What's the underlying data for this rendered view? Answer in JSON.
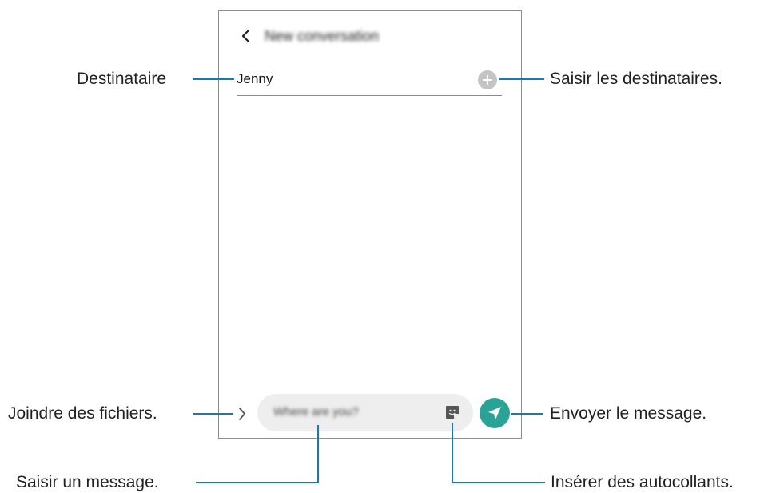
{
  "phone": {
    "title": "New conversation",
    "recipient_value": "Jenny",
    "message_placeholder": "Where are you?"
  },
  "callouts": {
    "recipient": "Destinataire",
    "enter_recipients": "Saisir les destinataires.",
    "attach_files": "Joindre des fichiers.",
    "send_message": "Envoyer le message.",
    "enter_message": "Saisir un message.",
    "insert_stickers": "Insérer des autocollants."
  },
  "icons": {
    "back": "back-arrow-icon",
    "add_recipient": "plus-circle-icon",
    "attach": "chevron-right-icon",
    "sticker": "sticker-icon",
    "send": "send-icon"
  },
  "colors": {
    "callout_line": "#1b75bb",
    "send_button": "#2aa397",
    "message_field": "#eeeeee"
  }
}
